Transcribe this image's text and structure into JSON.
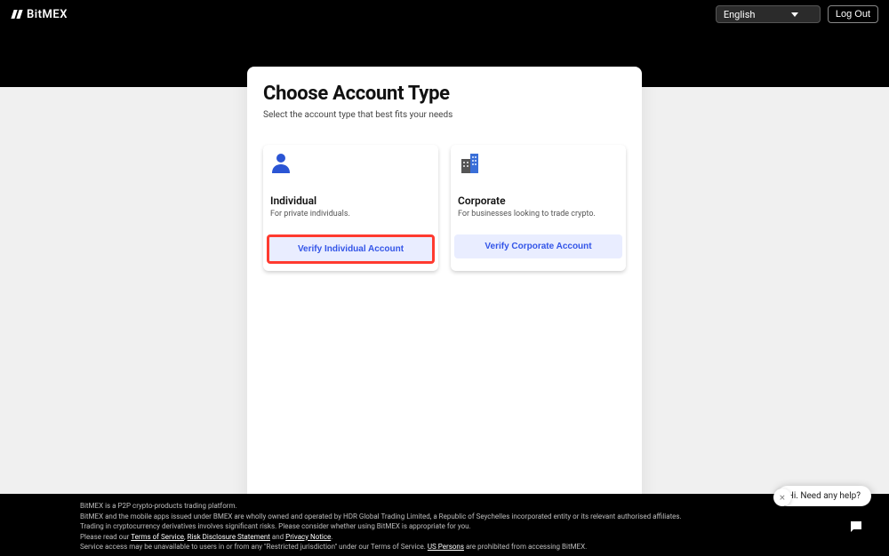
{
  "header": {
    "brand": "BitMEX",
    "language": "English",
    "logout": "Log Out"
  },
  "card": {
    "title": "Choose Account Type",
    "subtitle": "Select the account type that best fits your needs",
    "individual": {
      "title": "Individual",
      "desc": "For private individuals.",
      "button": "Verify Individual Account"
    },
    "corporate": {
      "title": "Corporate",
      "desc": "For businesses looking to trade crypto.",
      "button": "Verify Corporate Account"
    }
  },
  "help": {
    "text": "Hi. Need any help?"
  },
  "footer": {
    "l1": "BitMEX is a P2P crypto-products trading platform.",
    "l2": "BitMEX and the mobile apps issued under BMEX are wholly owned and operated by HDR Global Trading Limited, a Republic of Seychelles incorporated entity or its relevant authorised affiliates.",
    "l3": "Trading in cryptocurrency derivatives involves significant risks. Please consider whether using BitMEX is appropriate for you.",
    "l4a": "Please read our ",
    "tos": "Terms of Service",
    "sep": ", ",
    "rds": "Risk Disclosure Statement",
    "and": " and ",
    "pn": "Privacy Notice",
    "period": ".",
    "l5a": "Service access may be unavailable to users in or from any \"Restricted jurisdiction\" under our Terms of Service. ",
    "usp": "US Persons",
    "l5b": " are prohibited from accessing BitMEX."
  }
}
